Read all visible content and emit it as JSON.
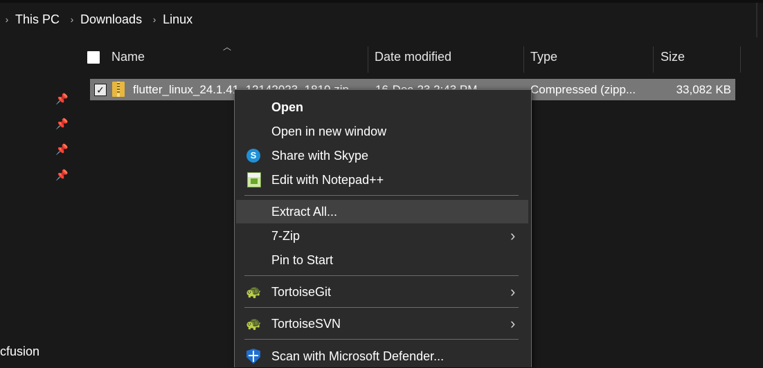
{
  "breadcrumb": {
    "items": [
      "This PC",
      "Downloads",
      "Linux"
    ],
    "separator": "›"
  },
  "nav": {
    "visible_label": "cfusion"
  },
  "columns": {
    "name": "Name",
    "date_modified": "Date modified",
    "type": "Type",
    "size": "Size"
  },
  "file": {
    "name": "flutter_linux_24.1.41_12142023_1810.zip",
    "date_modified": "16-Dec-23 2:43 PM",
    "type": "Compressed (zipp...",
    "size": "33,082 KB",
    "selected": true
  },
  "context_menu": {
    "items": [
      {
        "label": "Open",
        "bold": true,
        "icon": "",
        "submenu": false
      },
      {
        "label": "Open in new window",
        "bold": false,
        "icon": "",
        "submenu": false
      },
      {
        "label": "Share with Skype",
        "bold": false,
        "icon": "skype-icon",
        "submenu": false
      },
      {
        "label": "Edit with Notepad++",
        "bold": false,
        "icon": "notepad-plus-plus-icon",
        "submenu": false
      },
      {
        "label": "Extract All...",
        "bold": false,
        "icon": "",
        "submenu": false,
        "highlighted": true
      },
      {
        "label": "7-Zip",
        "bold": false,
        "icon": "",
        "submenu": true
      },
      {
        "label": "Pin to Start",
        "bold": false,
        "icon": "",
        "submenu": false
      },
      {
        "label": "TortoiseGit",
        "bold": false,
        "icon": "tortoisegit-icon",
        "submenu": true
      },
      {
        "label": "TortoiseSVN",
        "bold": false,
        "icon": "tortoisesvn-icon",
        "submenu": true
      },
      {
        "label": "Scan with Microsoft Defender...",
        "bold": false,
        "icon": "defender-shield-icon",
        "submenu": false
      }
    ],
    "skype_glyph": "S"
  },
  "colors": {
    "background": "#191919",
    "menu_background": "#2b2b2b",
    "selection": "#777777",
    "menu_highlight": "#414141"
  }
}
